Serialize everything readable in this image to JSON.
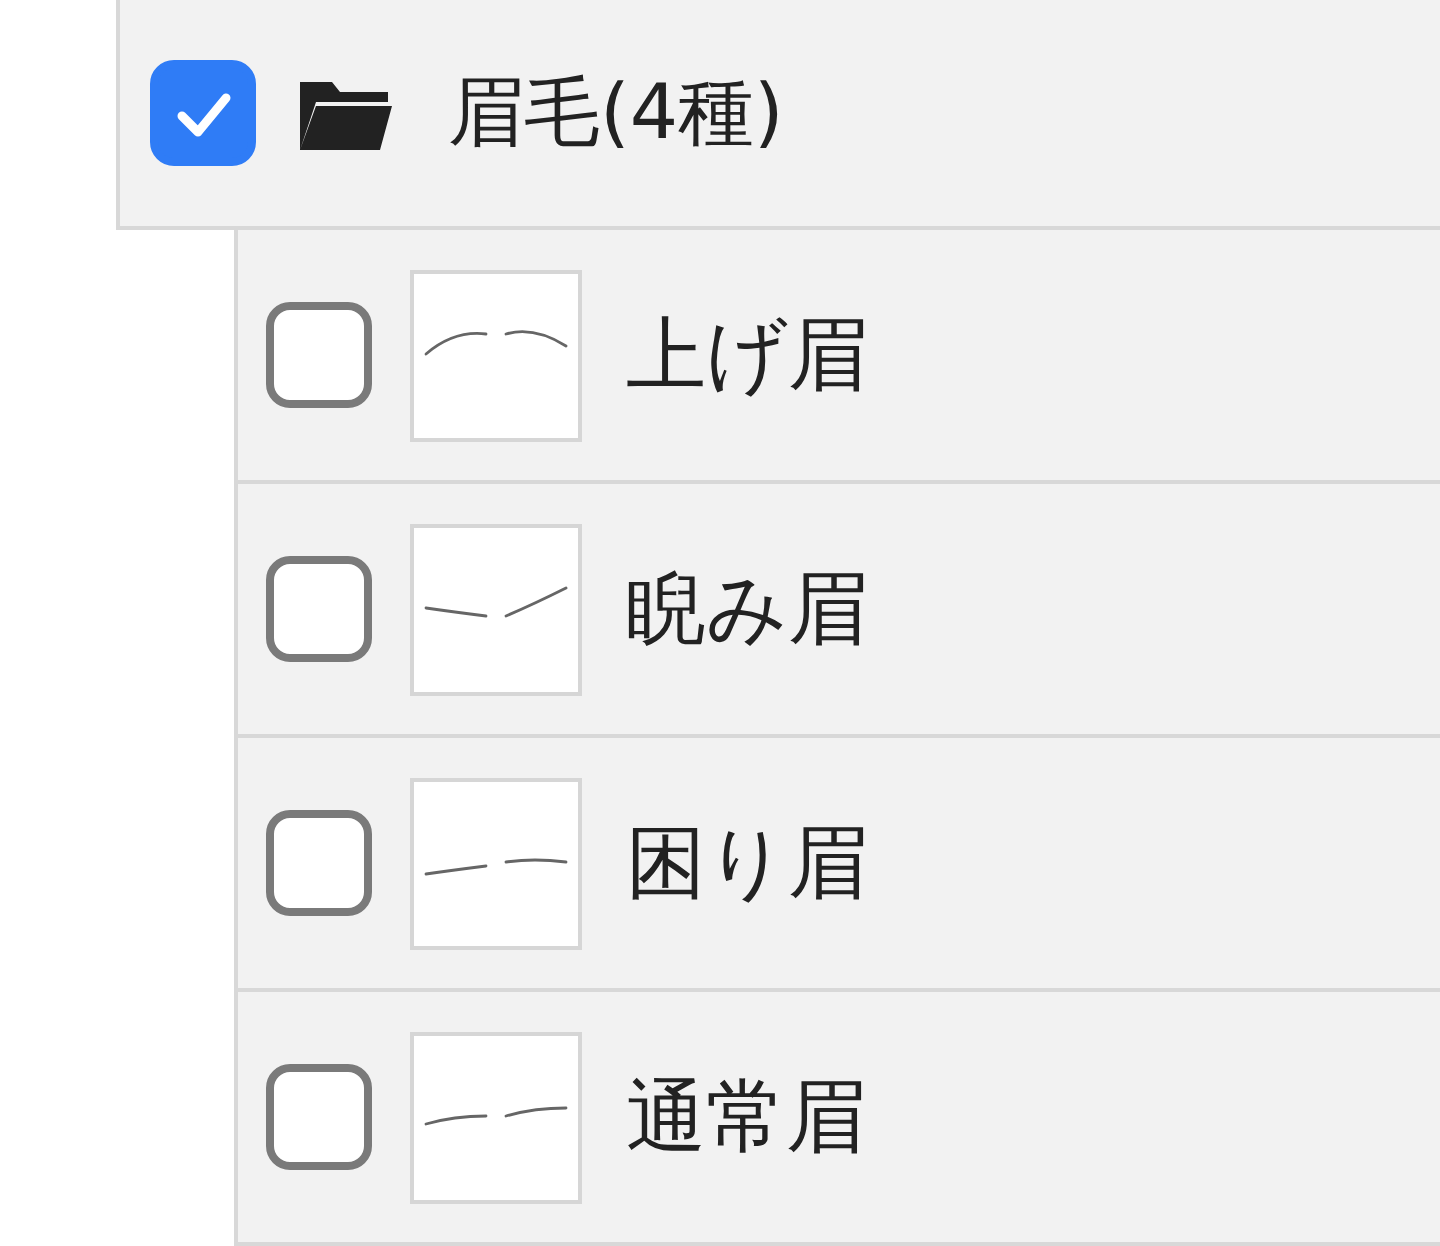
{
  "folder": {
    "name": "眉毛(4種)",
    "checked": true
  },
  "layers": [
    {
      "name": "上げ眉",
      "checked": false
    },
    {
      "name": "睨み眉",
      "checked": false
    },
    {
      "name": "困り眉",
      "checked": false
    },
    {
      "name": "通常眉",
      "checked": false
    }
  ]
}
